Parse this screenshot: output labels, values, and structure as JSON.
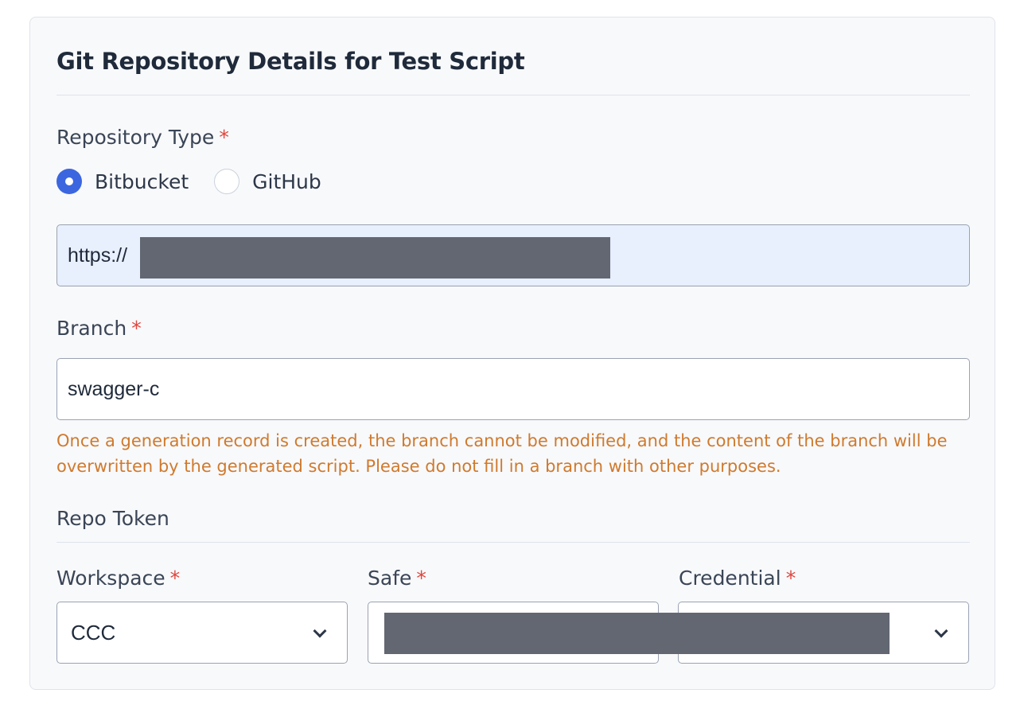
{
  "card": {
    "title": "Git Repository Details for Test Script"
  },
  "repository_type": {
    "label": "Repository Type",
    "required_mark": "*",
    "options": [
      {
        "label": "Bitbucket",
        "selected": true
      },
      {
        "label": "GitHub",
        "selected": false
      }
    ]
  },
  "repository_url": {
    "value": "https://"
  },
  "branch": {
    "label": "Branch",
    "required_mark": "*",
    "value": "swagger-c",
    "hint": "Once a generation record is created, the branch cannot be modified, and the content of the branch will be overwritten by the generated script. Please do not fill in a branch with other purposes."
  },
  "repo_token": {
    "section_label": "Repo Token",
    "workspace": {
      "label": "Workspace",
      "required_mark": "*",
      "value": "CCC"
    },
    "safe": {
      "label": "Safe",
      "required_mark": "*",
      "value": ""
    },
    "credential": {
      "label": "Credential",
      "required_mark": "*",
      "value": ""
    }
  },
  "colors": {
    "accent": "#3b66e0",
    "required": "#e0463e",
    "hint": "#cf7a2e",
    "redaction": "#636772"
  }
}
